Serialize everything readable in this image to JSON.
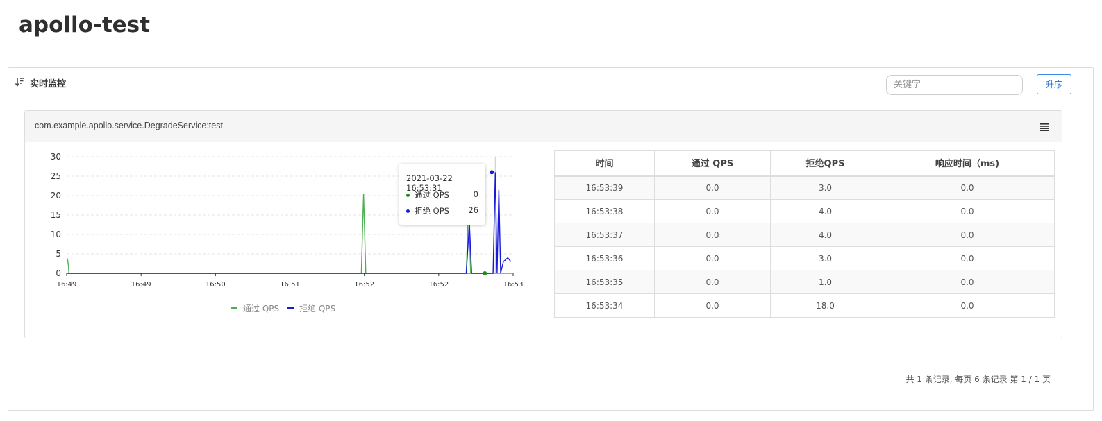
{
  "page": {
    "title": "apollo-test"
  },
  "panel": {
    "title": "实时监控",
    "search_placeholder": "关键字",
    "sort_label": "升序",
    "pagination": "共 1 条记录, 每页 6 条记录 第 1 / 1 页"
  },
  "card": {
    "title": "com.example.apollo.service.DegradeService:test"
  },
  "tooltip": {
    "time": "2021-03-22 16:53:31",
    "rows": [
      {
        "name": "通过 QPS",
        "value": "0",
        "color": "#1f8f1f"
      },
      {
        "name": "拒绝 QPS",
        "value": "26",
        "color": "#1a1ad6"
      }
    ]
  },
  "table": {
    "headers": [
      "时间",
      "通过 QPS",
      "拒绝QPS",
      "响应时间（ms)"
    ],
    "rows": [
      [
        "16:53:39",
        "0.0",
        "3.0",
        "0.0"
      ],
      [
        "16:53:38",
        "0.0",
        "4.0",
        "0.0"
      ],
      [
        "16:53:37",
        "0.0",
        "4.0",
        "0.0"
      ],
      [
        "16:53:36",
        "0.0",
        "3.0",
        "0.0"
      ],
      [
        "16:53:35",
        "0.0",
        "1.0",
        "0.0"
      ],
      [
        "16:53:34",
        "0.0",
        "18.0",
        "0.0"
      ]
    ]
  },
  "colors": {
    "pass": "#4caf50",
    "block": "#1a1ad6",
    "accent": "#1e6fd9"
  },
  "chart_data": {
    "type": "line",
    "ylim": [
      0,
      30
    ],
    "yticks": [
      0,
      5,
      10,
      15,
      20,
      25,
      30
    ],
    "xtick_labels": [
      "16:49",
      "16:49",
      "16:50",
      "16:51",
      "16:52",
      "16:52",
      "16:53"
    ],
    "legend": [
      "通过 QPS",
      "拒绝 QPS"
    ],
    "series": [
      {
        "name": "通过 QPS",
        "color": "#4caf50",
        "points": [
          [
            0,
            3
          ],
          [
            0.002,
            3.5
          ],
          [
            0.004,
            2
          ],
          [
            0.005,
            0
          ],
          [
            0.66,
            0
          ],
          [
            0.665,
            20.5
          ],
          [
            0.67,
            0
          ],
          [
            0.895,
            0
          ],
          [
            0.9,
            17
          ],
          [
            0.905,
            0
          ],
          [
            1.0,
            0
          ]
        ]
      },
      {
        "name": "拒绝 QPS",
        "color": "#1a1ad6",
        "points": [
          [
            0,
            0
          ],
          [
            0.895,
            0
          ],
          [
            0.902,
            13
          ],
          [
            0.907,
            0
          ],
          [
            0.955,
            0
          ],
          [
            0.96,
            26
          ],
          [
            0.964,
            0
          ],
          [
            0.968,
            21.5
          ],
          [
            0.972,
            0
          ],
          [
            0.978,
            3
          ],
          [
            0.988,
            4
          ],
          [
            0.995,
            3
          ]
        ]
      }
    ]
  }
}
